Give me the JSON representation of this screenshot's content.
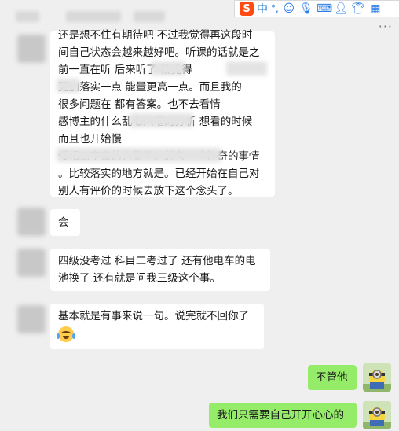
{
  "ime_toolbar": {
    "logo": "S",
    "mode": "中",
    "punct": "°,",
    "icons": [
      "emoji-icon",
      "mic-icon",
      "keyboard-icon",
      "user-icon",
      "shirt-icon",
      "grid-icon"
    ]
  },
  "more_menu": "···",
  "messages": [
    {
      "side": "left",
      "lines": [
        "还是想不住有期待吧 不过我觉得再这段时",
        "间自己状态会越来越好吧。听课的话就是之",
        "前一直在听          后来听了        就觉得",
        "     更加落实一点 能量更高一点。而且我的",
        "很多问题在           都有答案。也不去看情",
        "感博主的什么乱七八糟的分析 想看的时候",
        "                                    而且也开始慢",
        "慢相信宇宙的力量了。总有一些神奇的事情",
        "。比较落实的地方就是。已经开始在自己对",
        "别人有评价的时候去放下这个念头了。"
      ]
    },
    {
      "side": "left",
      "lines": [
        "会"
      ]
    },
    {
      "side": "left",
      "lines": [
        "四级没考过 科目二考过了 还有他电车的电",
        "池换了 还有就是问我三级这个事。"
      ]
    },
    {
      "side": "left",
      "lines": [
        "基本就是有事来说一句。说完就不回你了"
      ],
      "emoji": "crying-laughing-emoji"
    },
    {
      "side": "right",
      "lines": [
        "不管他"
      ]
    },
    {
      "side": "right",
      "lines": [
        "我们只需要自己开开心心的"
      ]
    }
  ],
  "colors": {
    "background": "#efefef",
    "bubble_left": "#ffffff",
    "bubble_right": "#95ec69",
    "ime_accent": "#2b7de9",
    "ime_logo": "#ff4b12"
  }
}
